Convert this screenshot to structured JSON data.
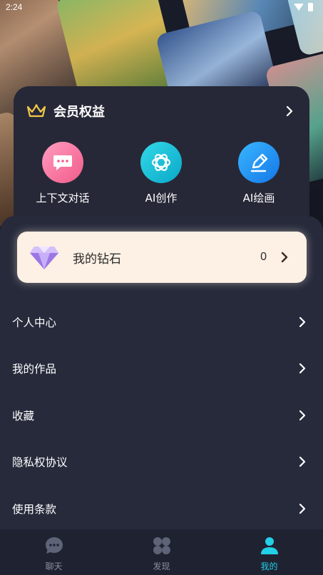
{
  "status_bar": {
    "time": "2:24"
  },
  "membership": {
    "title": "会员权益",
    "features": [
      {
        "label": "上下文对话",
        "icon": "chat-bubble-icon"
      },
      {
        "label": "AI创作",
        "icon": "ai-swirl-icon"
      },
      {
        "label": "AI绘画",
        "icon": "pencil-icon"
      }
    ]
  },
  "diamonds": {
    "label": "我的钻石",
    "count": "0"
  },
  "menu": [
    {
      "label": "个人中心"
    },
    {
      "label": "我的作品"
    },
    {
      "label": "收藏"
    },
    {
      "label": "隐私权协议"
    },
    {
      "label": "使用条款"
    }
  ],
  "bottom_nav": [
    {
      "label": "聊天",
      "icon": "chat-icon",
      "active": false
    },
    {
      "label": "发现",
      "icon": "discover-icon",
      "active": false
    },
    {
      "label": "我的",
      "icon": "profile-icon",
      "active": true
    }
  ],
  "colors": {
    "accent": "#22d0e8",
    "panel": "#262a3b",
    "card": "#fdf0e4",
    "crown": "#f3c94a"
  }
}
